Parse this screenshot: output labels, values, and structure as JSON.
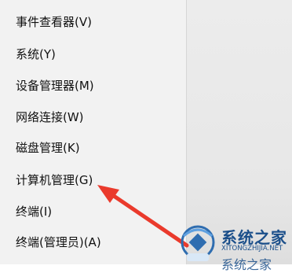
{
  "menu": {
    "items": [
      {
        "label": "事件查看器(V)"
      },
      {
        "label": "系统(Y)"
      },
      {
        "label": "设备管理器(M)"
      },
      {
        "label": "网络连接(W)"
      },
      {
        "label": "磁盘管理(K)"
      },
      {
        "label": "计算机管理(G)"
      },
      {
        "label": "终端(I)"
      },
      {
        "label": "终端(管理员)(A)"
      }
    ]
  },
  "watermark": {
    "title": "系统之家",
    "domain": "XITONGZHIJIA.NET",
    "extra": "系统之家"
  },
  "colors": {
    "menu_background": "#f2f2f2",
    "arrow": "#ea3a2c",
    "watermark": "#1b4f8a"
  }
}
